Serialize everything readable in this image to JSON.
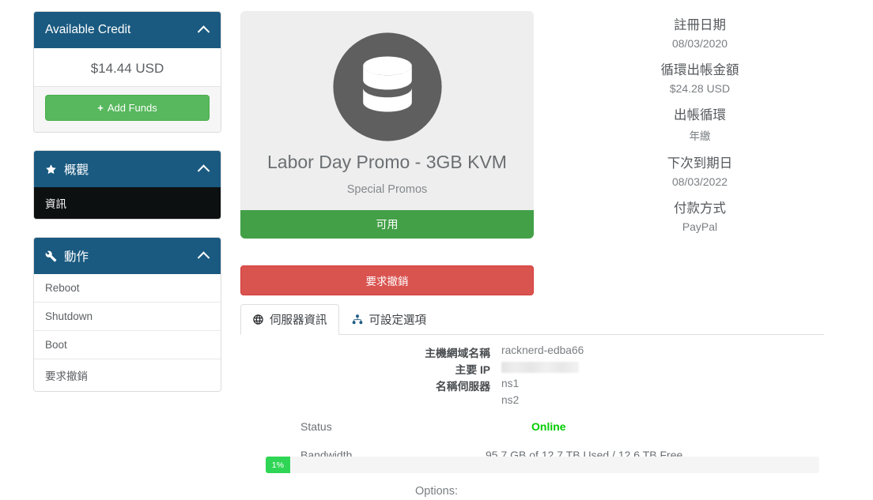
{
  "sidebar": {
    "credit_panel": {
      "title": "Available Credit",
      "amount": "$14.44 USD",
      "add_funds_label": "Add Funds",
      "plus": "+",
      "collapse_icon": "chevron-up-icon"
    },
    "overview_panel": {
      "title": "概觀",
      "icon": "star-icon",
      "collapse_icon": "chevron-up-icon",
      "items": [
        {
          "label": "資訊",
          "active": true
        }
      ]
    },
    "actions_panel": {
      "title": "動作",
      "icon": "wrench-icon",
      "collapse_icon": "chevron-up-icon",
      "items": [
        {
          "label": "Reboot"
        },
        {
          "label": "Shutdown"
        },
        {
          "label": "Boot"
        },
        {
          "label": "要求撤銷"
        }
      ]
    }
  },
  "product": {
    "icon": "database-icon",
    "title": "Labor Day Promo - 3GB KVM",
    "subtitle": "Special Promos",
    "status_label": "可用",
    "cancel_button": "要求撤銷"
  },
  "info": [
    {
      "label": "註冊日期",
      "value": "08/03/2020"
    },
    {
      "label": "循環出帳金額",
      "value": "$24.28 USD"
    },
    {
      "label": "出帳循環",
      "value": "年繳"
    },
    {
      "label": "下次到期日",
      "value": "08/03/2022"
    },
    {
      "label": "付款方式",
      "value": "PayPal"
    }
  ],
  "tabs": [
    {
      "label": "伺服器資訊",
      "icon": "globe-icon",
      "active": true
    },
    {
      "label": "可設定選項",
      "icon": "sitemap-icon",
      "active": false
    }
  ],
  "details": {
    "rows": [
      {
        "label": "主機網域名稱",
        "value": "racknerd-edba66",
        "redacted": false
      },
      {
        "label": "主要 IP",
        "value": "",
        "redacted": true
      },
      {
        "label": "名稱伺服器",
        "value": "ns1",
        "redacted": false
      },
      {
        "label": "",
        "value": "ns2",
        "redacted": false
      }
    ],
    "status_label": "Status",
    "status_value": "Online",
    "bandwidth_label": "Bandwidth",
    "bandwidth_value": "95.7 GB of 12.7 TB Used / 12.6 TB Free",
    "bandwidth_percent": "1%",
    "options_label": "Options:"
  },
  "colors": {
    "header_blue": "#1a5a80",
    "green": "#57b85d",
    "status_green": "#43a047",
    "red": "#d9534f",
    "online_green": "#00cc00",
    "progress_green": "#2fd655",
    "active_item": "#0d1011"
  }
}
